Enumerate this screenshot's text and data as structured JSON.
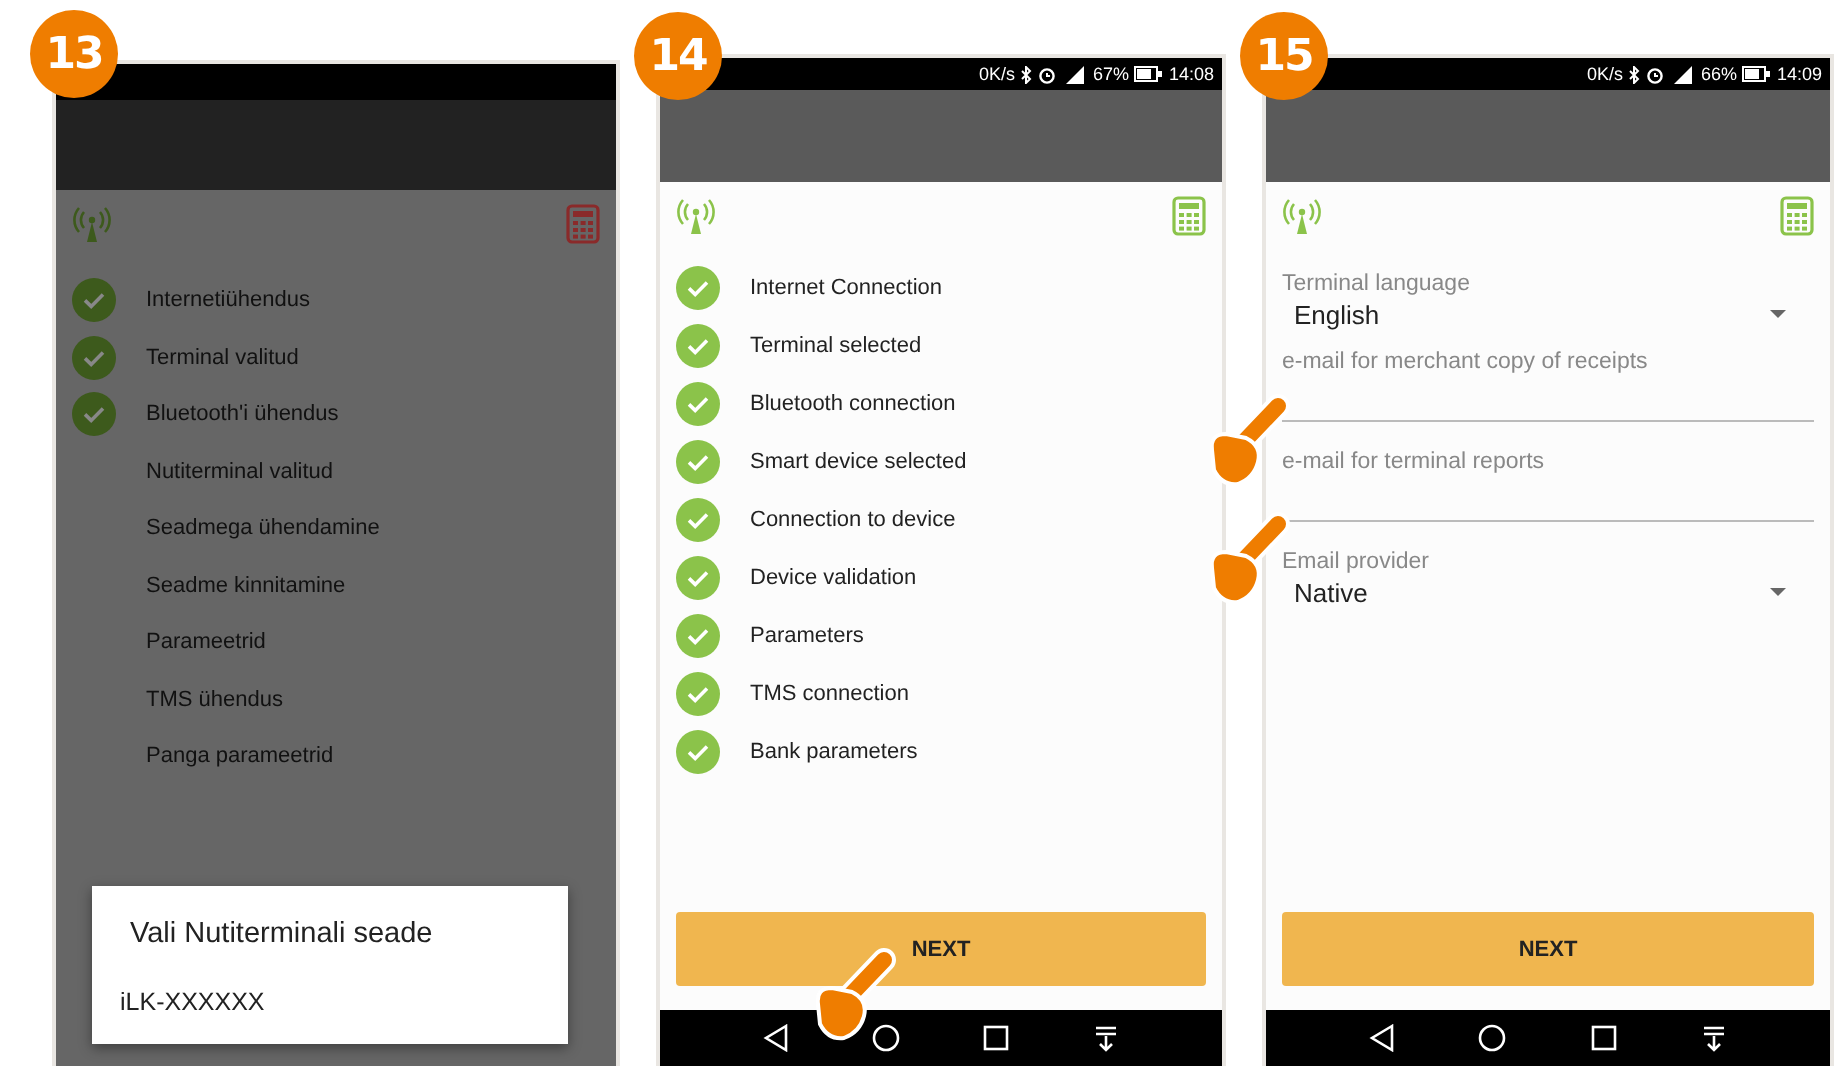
{
  "screens": [
    {
      "number": "13",
      "kind": "checklist",
      "dimmed": true,
      "terminal_ready": false,
      "steps": [
        {
          "label": "Internetiühendus",
          "done": true
        },
        {
          "label": "Terminal valitud",
          "done": true
        },
        {
          "label": "Bluetooth'i ühendus",
          "done": true
        },
        {
          "label": "Nutiterminal valitud",
          "done": false
        },
        {
          "label": "Seadmega ühendamine",
          "done": false
        },
        {
          "label": "Seadme kinnitamine",
          "done": false
        },
        {
          "label": "Parameetrid",
          "done": false
        },
        {
          "label": "TMS ühendus",
          "done": false
        },
        {
          "label": "Panga parameetrid",
          "done": false
        }
      ],
      "dialog": {
        "title": "Vali Nutiterminali seade",
        "items": [
          "iLK-XXXXXX"
        ]
      }
    },
    {
      "number": "14",
      "kind": "checklist",
      "dimmed": false,
      "terminal_ready": true,
      "status_bar": {
        "speed": "0K/s",
        "battery": "67%",
        "time": "14:08"
      },
      "steps": [
        {
          "label": "Internet Connection",
          "done": true
        },
        {
          "label": "Terminal selected",
          "done": true
        },
        {
          "label": "Bluetooth connection",
          "done": true
        },
        {
          "label": "Smart device selected",
          "done": true
        },
        {
          "label": "Connection to device",
          "done": true
        },
        {
          "label": "Device validation",
          "done": true
        },
        {
          "label": "Parameters",
          "done": true
        },
        {
          "label": "TMS connection",
          "done": true
        },
        {
          "label": "Bank parameters",
          "done": true
        }
      ],
      "button": "NEXT"
    },
    {
      "number": "15",
      "kind": "settings",
      "dimmed": false,
      "terminal_ready": true,
      "status_bar": {
        "speed": "0K/s",
        "battery": "66%",
        "time": "14:09"
      },
      "fields": [
        {
          "kind": "dropdown",
          "label": "Terminal language",
          "value": "English"
        },
        {
          "kind": "text",
          "label": "e-mail for merchant copy of receipts"
        },
        {
          "kind": "text",
          "label": "e-mail for terminal reports"
        },
        {
          "kind": "dropdown",
          "label": "Email provider",
          "value": "Native"
        }
      ],
      "button": "NEXT"
    }
  ]
}
